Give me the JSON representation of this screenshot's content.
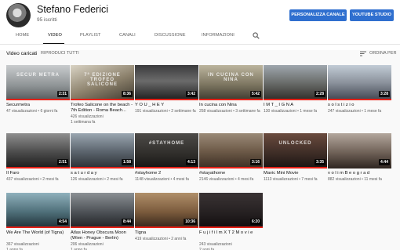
{
  "channel": {
    "name": "Stefano Federici",
    "subscribers": "95 iscritti",
    "customize_label": "PERSONALIZZA CANALE",
    "studio_label": "YOUTUBE STUDIO"
  },
  "tabs": [
    {
      "label": "HOME"
    },
    {
      "label": "VIDEO"
    },
    {
      "label": "PLAYLIST"
    },
    {
      "label": "CANALI"
    },
    {
      "label": "DISCUSSIONE"
    },
    {
      "label": "INFORMAZIONI"
    }
  ],
  "section": {
    "title": "Video caricati",
    "play_all": "RIPRODUCI TUTTI",
    "sort_label": "ORDINA PER"
  },
  "colors": {
    "accent_blue": "#2f6fcf",
    "progress_red": "#e62117"
  },
  "videos": [
    {
      "title": "Securmetra",
      "views": "47 visualizzazioni",
      "age": "6 giorni fa",
      "duration": "2:31",
      "watched": 1.0,
      "thumb_text": "SECUR METRA"
    },
    {
      "title": "Trofeo Salicone on the beach - 7th Edition - Roma Beach...",
      "views": "426 visualizzazioni",
      "age": "1 settimana fa",
      "duration": "8:36",
      "watched": 1.0,
      "thumb_text": "7ª EDIZIONE TROFEO SALICONE"
    },
    {
      "title": "Y O U _ H E Y",
      "views": "191 visualizzazioni",
      "age": "2 settimane fa",
      "duration": "3:42",
      "watched": 1.0,
      "thumb_text": ""
    },
    {
      "title": "In cucina con Nina",
      "views": "258 visualizzazioni",
      "age": "3 settimane fa",
      "duration": "5:42",
      "watched": 1.0,
      "thumb_text": "IN CUCINA CON NINA"
    },
    {
      "title": "I M T _ I G N A",
      "views": "130 visualizzazioni",
      "age": "1 mese fa",
      "duration": "2:28",
      "watched": 1.0,
      "thumb_text": ""
    },
    {
      "title": "s o l s t i z i o",
      "views": "247 visualizzazioni",
      "age": "1 mese fa",
      "duration": "3:28",
      "watched": 1.0,
      "thumb_text": ""
    },
    {
      "title": "Il Faro",
      "views": "437 visualizzazioni",
      "age": "2 mesi fa",
      "duration": "2:51",
      "watched": 1.0,
      "thumb_text": ""
    },
    {
      "title": "s a t u r d a y",
      "views": "126 visualizzazioni",
      "age": "2 mesi fa",
      "duration": "1:58",
      "watched": 1.0,
      "thumb_text": ""
    },
    {
      "title": "#stayhome 2",
      "views": "1148 visualizzazioni",
      "age": "4 mesi fa",
      "duration": "4:13",
      "watched": 1.0,
      "thumb_text": "#STAYHOME"
    },
    {
      "title": "#stayathome",
      "views": "2146 visualizzazioni",
      "age": "4 mesi fa",
      "duration": "3:16",
      "watched": 1.0,
      "thumb_text": ""
    },
    {
      "title": "Mavic Mini Movie",
      "views": "1113 visualizzazioni",
      "age": "7 mesi fa",
      "duration": "3:35",
      "watched": 1.0,
      "thumb_text": "UNLOCKED"
    },
    {
      "title": "v o l i m B e o g r a d",
      "views": "882 visualizzazioni",
      "age": "11 mesi fa",
      "duration": "4:44",
      "watched": 0.0,
      "thumb_text": ""
    },
    {
      "title": "We Are The World (of Tigna)",
      "views": "367 visualizzazioni",
      "age": "1 anno fa",
      "duration": "4:54",
      "watched": 1.0,
      "thumb_text": ""
    },
    {
      "title": "Atlas Honey Obscura Moon (Wien - Prague - Berlin)",
      "views": "206 visualizzazioni",
      "age": "1 anno fa",
      "duration": "8:44",
      "watched": 1.0,
      "thumb_text": ""
    },
    {
      "title": "Tigna",
      "views": "419 visualizzazioni",
      "age": "2 anni fa",
      "duration": "10:36",
      "watched": 1.0,
      "thumb_text": ""
    },
    {
      "title": "F u j i f i l m X T 2 M o v i e",
      "views": "243 visualizzazioni",
      "age": "2 anni fa",
      "duration": "6:20",
      "watched": 1.0,
      "thumb_text": ""
    }
  ]
}
